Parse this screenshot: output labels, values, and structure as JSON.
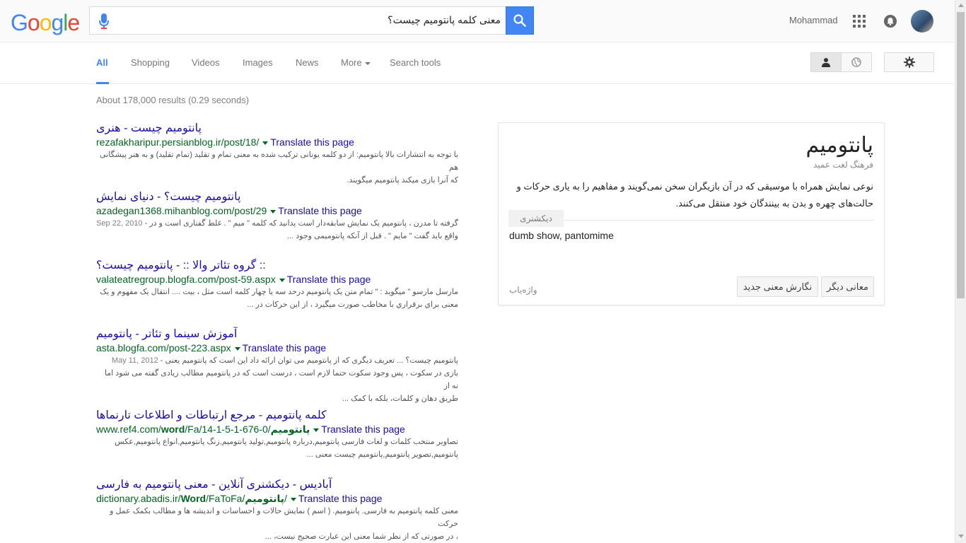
{
  "header": {
    "logo_letters": [
      "G",
      "o",
      "o",
      "g",
      "l",
      "e"
    ],
    "logo_colors": [
      "#4285f4",
      "#ea4335",
      "#fbbc05",
      "#4285f4",
      "#34a853",
      "#ea4335"
    ],
    "search_query": "معنی کلمه پانتومیم چیست؟",
    "user_name": "Mohammad",
    "accent_color": "#4285f4"
  },
  "tabs": {
    "all": "All",
    "shopping": "Shopping",
    "videos": "Videos",
    "images": "Images",
    "news": "News",
    "more": "More",
    "search_tools": "Search tools"
  },
  "result_stats": "About 178,000 results (0.29 seconds)",
  "results": [
    {
      "title": "پانتومیم چیست - هنری",
      "url": "rezafakharipur.persianblog.ir/post/18/",
      "translate": "Translate this page",
      "snippet_1": "با توجه به انتشارات بالا پانتومیم: از دو کلمه یونانی ترکیب شده به معنی تمام و تقلید (تمام تقلید) و به هنر پیشگانی هم",
      "snippet_2": "که آنرا بازی میکند پانتومیم میگویند.",
      "date": ""
    },
    {
      "title": "پانتومیم چیست؟ - دنیای نمایش",
      "url": "azadegan1368.mihanblog.com/post/29",
      "translate": "Translate this page",
      "snippet_1": "گرفته تا مدرن ، پانتومیم یک نمایش سابقه‌دار است یدانید که کلمه \" میم \" . غلط گفتاری است و در -",
      "snippet_2": "واقع باید گفت \" مایم \" . قبل از آنکه پانتومیمی وجود ...",
      "date": "Sep 22, 2010"
    },
    {
      "title": ":: گروه تئاتر والا :: - پانتومیم چیست؟",
      "url": "valateatregroup.blogfa.com/post-59.aspx",
      "translate": "Translate this page",
      "snippet_1": "مارسل مارسو \" میگوید : \" تمام متن یک پانتومیم درحد سه یا چهار کلمه است مثل ، بیت .... انتقال یک مفهوم و یک",
      "snippet_2": "معنی براي برقراري با مخاطب صورت میگیرد ، از این حرکات در ...",
      "date": ""
    },
    {
      "title": "آموزش سینما و تئاتر - پانتومیم",
      "url": "asta.blogfa.com/post-223.aspx",
      "translate": "Translate this page",
      "snippet_1": "پانتومیم چیست؟ ... تعریف دیگری که از پانتومیم می توان ارائه داد این است که پانتومیم یعنی -",
      "snippet_2": "بازی در سکوت ، پس وجود سکوت حتما لازم است ، درست است که در پانتومیم مطالب زیادی گفته می شود اما نه از",
      "snippet_3": "طریق دهان و کلمات، بلکه با کمک ...",
      "date": "May 11, 2012"
    },
    {
      "title": "کلمه پانتومیم - مرجع ارتباطات و اطلاعات تارنماها",
      "url_prefix": "www.ref4.com/",
      "url_bold_1": "word",
      "url_middle": "/Fa/14-1-5-1-676-0/",
      "url_bold_2": "پانتومیم",
      "translate": "Translate this page",
      "snippet_1": "تصاویر منتخب کلمات و لغات فارسی پانتومیم,درباره پانتومیم,تولید پانتومیم,زنگ پانتومیم,انواع پانتومیم,عکس",
      "snippet_2": "پانتومیم,تصویر پانتومیم,پانتومیم چیست معنی ...",
      "date": ""
    },
    {
      "title": "آبادیس - دیکشنری آنلاین - معنی پانتومیم به فارسی",
      "url_prefix": "dictionary.abadis.ir/",
      "url_bold_1": "Word",
      "url_middle": "/FaToFa/",
      "url_bold_2": "پانتومیم",
      "url_suffix": "/",
      "translate": "Translate this page",
      "snippet_1": "معنی کلمه پانتومیم به فارسی. پانتومیم. ( اسم ) نمایش حالات و احساسات و اندیشه ها و مطالب بکمک عمل و حرکت",
      "snippet_2": "، در صورتی که از نظر شما معنی این عبارت صحیح نیست، ...",
      "date": ""
    }
  ],
  "card": {
    "title": "پانتومیم",
    "source": "فرهنگ لغت عمید",
    "definition": "نوعی نمایش همراه با موسیقی که در آن بازیگران سخن نمی‌گویند و مفاهیم را به یاری حرکات و حالت‌های چهره و بدن به بینندگان خود منتقل می‌کنند.",
    "tab_label": "دیکشنری",
    "english": "dumb show, pantomime",
    "footer_source": "واژه‌یاب",
    "btn_other": "معانی دیگر",
    "btn_new": "نگارش معنی جدید"
  }
}
